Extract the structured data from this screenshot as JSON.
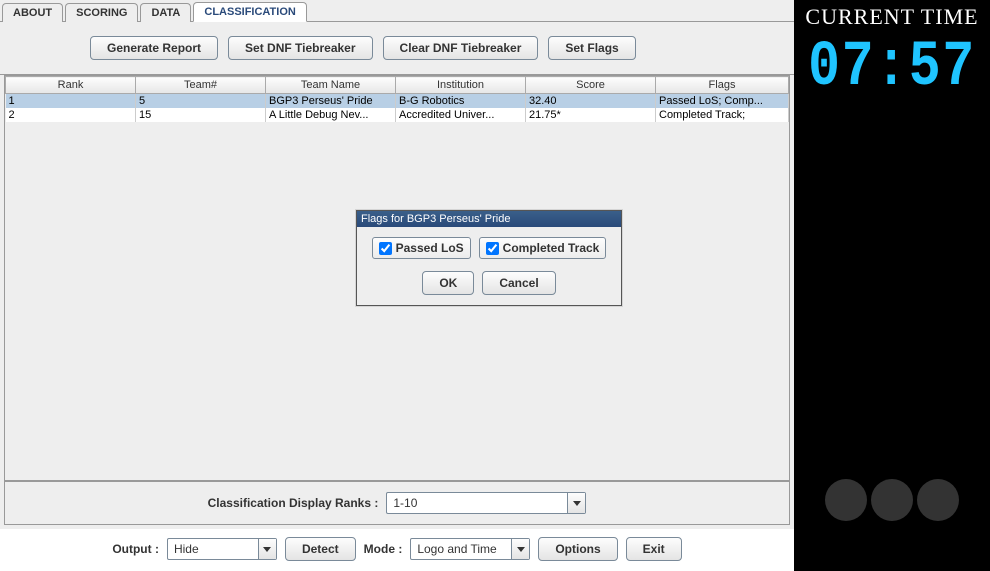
{
  "tabs": [
    "ABOUT",
    "SCORING",
    "DATA",
    "CLASSIFICATION"
  ],
  "activeTab": "CLASSIFICATION",
  "toolbar": {
    "generate": "Generate Report",
    "setDnf": "Set DNF Tiebreaker",
    "clearDnf": "Clear DNF Tiebreaker",
    "setFlags": "Set Flags"
  },
  "table": {
    "columns": [
      "Rank",
      "Team#",
      "Team Name",
      "Institution",
      "Score",
      "Flags"
    ],
    "rows": [
      {
        "rank": "1",
        "team": "5",
        "name": "BGP3 Perseus' Pride",
        "inst": "B-G Robotics",
        "score": "32.40",
        "flags": "Passed LoS; Comp...",
        "selected": true
      },
      {
        "rank": "2",
        "team": "15",
        "name": "A Little Debug Nev...",
        "inst": "Accredited Univer...",
        "score": "21.75*",
        "flags": "Completed Track;",
        "selected": false
      }
    ]
  },
  "classifRow": {
    "label": "Classification Display Ranks :",
    "value": "1-10"
  },
  "footer": {
    "outputLabel": "Output :",
    "outputValue": "Hide",
    "detect": "Detect",
    "modeLabel": "Mode :",
    "modeValue": "Logo and Time",
    "options": "Options",
    "exit": "Exit"
  },
  "clock": {
    "title": "CURRENT TIME",
    "value": "07:57"
  },
  "dialog": {
    "title": "Flags for BGP3 Perseus' Pride",
    "check1": "Passed LoS",
    "check2": "Completed Track",
    "ok": "OK",
    "cancel": "Cancel"
  }
}
